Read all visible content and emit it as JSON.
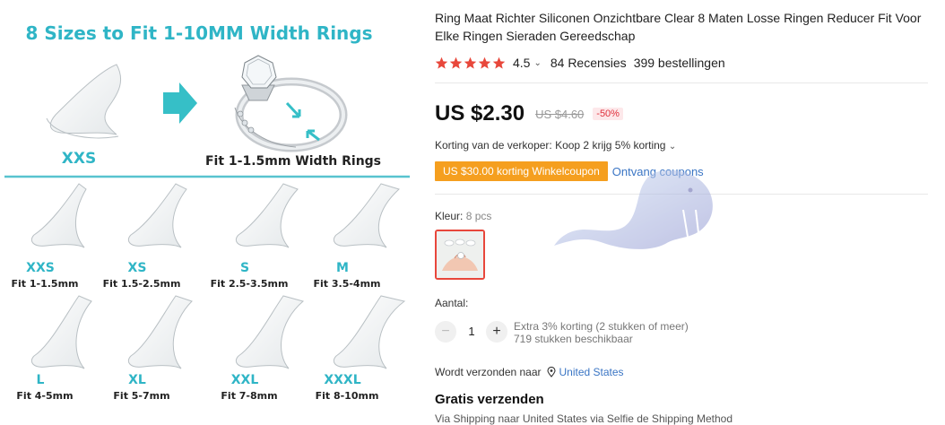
{
  "image": {
    "title": "8 Sizes to Fit 1-10MM Width Rings",
    "demo_size": "XXS",
    "demo_fit": "Fit 1-1.5mm Width Rings",
    "grid": [
      {
        "size": "XXS",
        "fit": "Fit 1-1.5mm"
      },
      {
        "size": "XS",
        "fit": "Fit 1.5-2.5mm"
      },
      {
        "size": "S",
        "fit": "Fit 2.5-3.5mm"
      },
      {
        "size": "M",
        "fit": "Fit 3.5-4mm"
      },
      {
        "size": "L",
        "fit": "Fit 4-5mm"
      },
      {
        "size": "XL",
        "fit": "Fit 5-7mm"
      },
      {
        "size": "XXL",
        "fit": "Fit 7-8mm"
      },
      {
        "size": "XXXL",
        "fit": "Fit 8-10mm"
      }
    ],
    "colors": {
      "accent": "#2fb5c6",
      "arrow": "#36bfc7",
      "divider": "#58c3cf"
    }
  },
  "product": {
    "title": "Ring Maat Richter Siliconen Onzichtbare Clear 8 Maten Losse Ringen Reducer Fit Voor Elke Ringen Sieraden Gereedschap",
    "rating": {
      "stars": 5,
      "value": "4.5",
      "reviews": "84 Recensies",
      "orders": "399 bestellingen"
    },
    "price": {
      "current": "US $2.30",
      "original": "US $4.60",
      "discount": "-50%"
    },
    "seller_discount": "Korting van de verkoper: Koop 2 krijg 5% korting",
    "coupon": {
      "label": "US $30.00 korting Winkelcoupon",
      "link": "Ontvang coupons"
    },
    "color": {
      "label": "Kleur: ",
      "value": "8 pcs"
    },
    "quantity": {
      "label": "Aantal:",
      "value": "1",
      "minus": "−",
      "plus": "+",
      "extra_line1": "Extra 3% korting (2 stukken of meer)",
      "extra_line2": "719 stukken beschikbaar"
    },
    "shipping": {
      "label": "Wordt verzonden naar",
      "location": "United States",
      "title": "Gratis verzenden",
      "cut_line": "Via Shipping naar United States via Selfie de Shipping Method"
    },
    "colors": {
      "star": "#e8473b",
      "price": "#111111",
      "discount": "#e0303c",
      "coupon_bg": "#f59f1f",
      "link": "#3a75c4"
    }
  }
}
